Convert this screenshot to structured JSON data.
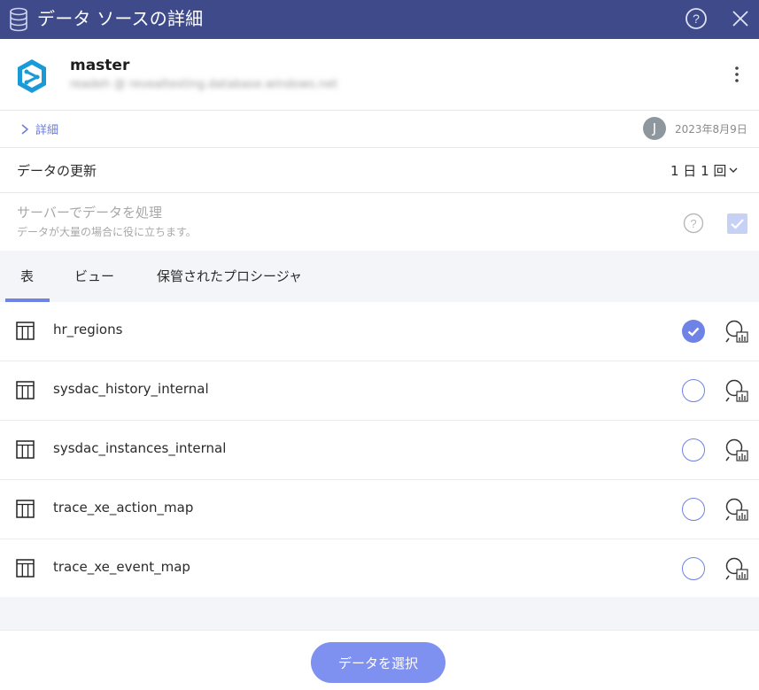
{
  "header": {
    "title": "データ ソースの詳細",
    "icons": {
      "database": "database-icon",
      "help": "help-icon",
      "close": "close-icon"
    }
  },
  "source": {
    "name": "master",
    "host": "readeh @ revealtesting.database.windows.net",
    "icons": {
      "logo": "azure-sql-logo",
      "menu": "more-vertical-icon"
    }
  },
  "details": {
    "link_label": "詳細",
    "avatar_letter": "J",
    "date": "2023年8月9日"
  },
  "refresh": {
    "label": "データの更新",
    "value": "1 日 1 回"
  },
  "server_processing": {
    "label": "サーバーでデータを処理",
    "sub": "データが大量の場合に役に立ちます。",
    "checked": true
  },
  "tabs": [
    {
      "label": "表",
      "active": true
    },
    {
      "label": "ビュー",
      "active": false
    },
    {
      "label": "保管されたプロシージャ",
      "active": false
    }
  ],
  "tables": [
    {
      "name": "hr_regions",
      "selected": true
    },
    {
      "name": "sysdac_history_internal",
      "selected": false
    },
    {
      "name": "sysdac_instances_internal",
      "selected": false
    },
    {
      "name": "trace_xe_action_map",
      "selected": false
    },
    {
      "name": "trace_xe_event_map",
      "selected": false
    }
  ],
  "footer": {
    "primary_label": "データを選択"
  },
  "colors": {
    "header_bg": "#3f4a8a",
    "accent": "#6f82e6",
    "button_bg": "#7e90f0"
  }
}
